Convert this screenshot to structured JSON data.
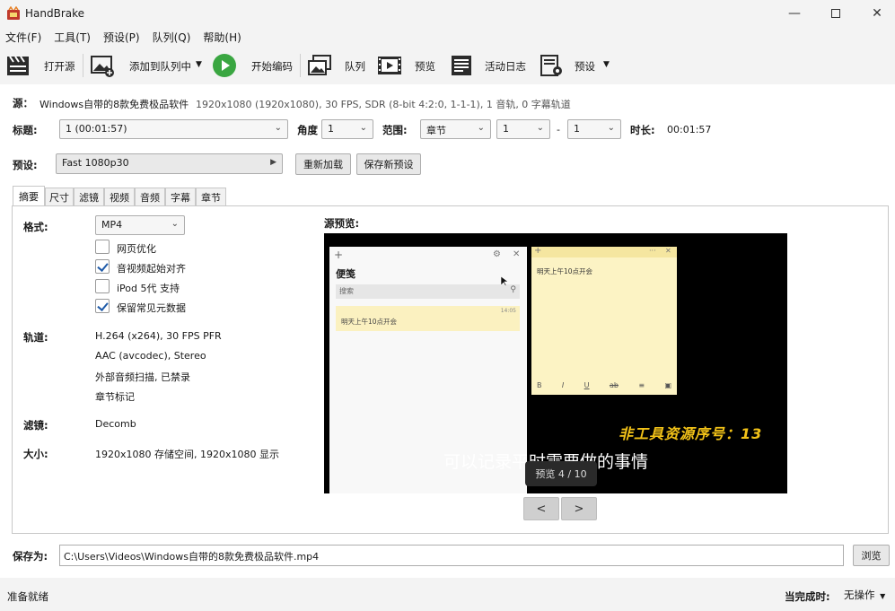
{
  "window": {
    "title": "HandBrake"
  },
  "menu": [
    "文件(F)",
    "工具(T)",
    "预设(P)",
    "队列(Q)",
    "帮助(H)"
  ],
  "toolbar": {
    "open_source": "打开源",
    "add_to_queue": "添加到队列中",
    "start_encode": "开始编码",
    "queue": "队列",
    "preview": "预览",
    "activity_log": "活动日志",
    "presets": "预设"
  },
  "source": {
    "label": "源：",
    "name": "Windows自带的8款免费极品软件",
    "info": "1920x1080 (1920x1080), 30 FPS, SDR (8-bit 4:2:0, 1-1-1), 1 音轨, 0 字幕轨道"
  },
  "title_row": {
    "title_label": "标题:",
    "title_value": "1  (00:01:57)",
    "angle_label": "角度",
    "angle_value": "1",
    "range_label": "范围:",
    "range_type": "章节",
    "range_start": "1",
    "range_dash": "-",
    "range_end": "1",
    "duration_label": "时长:",
    "duration_value": "00:01:57"
  },
  "preset_row": {
    "label": "预设:",
    "value": "Fast 1080p30",
    "reload": "重新加载",
    "save_new": "保存新预设"
  },
  "tabs": [
    "摘要",
    "尺寸",
    "滤镜",
    "视频",
    "音频",
    "字幕",
    "章节"
  ],
  "summary": {
    "format_label": "格式:",
    "format_value": "MP4",
    "options": [
      {
        "label": "网页优化",
        "checked": false
      },
      {
        "label": "音视频起始对齐",
        "checked": true
      },
      {
        "label": "iPod 5代 支持",
        "checked": false
      },
      {
        "label": "保留常见元数据",
        "checked": true
      }
    ],
    "tracks_label": "轨道:",
    "tracks": [
      "H.264 (x264), 30 FPS PFR",
      "AAC (avcodec), Stereo",
      "外部音频扫描, 已禁录",
      "章节标记"
    ],
    "filters_label": "滤镜:",
    "filters_value": "Decomb",
    "size_label": "大小:",
    "size_value": "1920x1080 存储空间, 1920x1080 显示",
    "preview_label": "源预览:"
  },
  "preview": {
    "notes_title": "便笺",
    "search_placeholder": "搜索",
    "note_text": "明天上午10点开会",
    "note_date": "14:05",
    "editor_text": "明天上午10点开会",
    "watermark": "非工具资源序号：13",
    "subtitle": "可以记录平时需要做的事情",
    "counter": "预览 4 / 10",
    "prev": "<",
    "next": ">"
  },
  "save": {
    "label": "保存为:",
    "path": "C:\\Users\\Videos\\Windows自带的8款免费极品软件.mp4",
    "browse": "浏览"
  },
  "status": {
    "left": "准备就绪",
    "when_done_label": "当完成时:",
    "when_done_value": "无操作"
  }
}
